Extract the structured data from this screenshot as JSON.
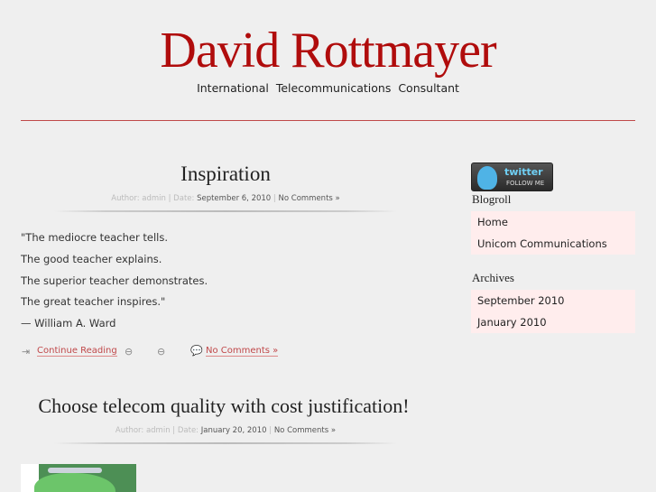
{
  "header": {
    "title": "David Rottmayer",
    "tagline": "International  Telecommunications  Consultant"
  },
  "posts": [
    {
      "title": "Inspiration",
      "meta_prefix": "Author: admin | Date: ",
      "date": "September 6, 2010",
      "meta_sep": " | ",
      "comments": "No Comments »",
      "lines": [
        "\"The mediocre teacher tells.",
        "The good teacher explains.",
        "The superior teacher demonstrates.",
        "The great teacher inspires.\"",
        "— William A. Ward"
      ],
      "continue": "Continue Reading",
      "comments_link": "No Comments »"
    },
    {
      "title": "Choose telecom quality with cost justification!",
      "meta_prefix": "Author: admin | Date: ",
      "date": "January 20, 2010",
      "meta_sep": " | ",
      "comments": "No Comments »"
    }
  ],
  "sidebar": {
    "twitter": {
      "brand": "twitter",
      "label": "FOLLOW ME"
    },
    "blogroll": {
      "heading": "Blogroll",
      "items": [
        "Home",
        "Unicom Communications"
      ]
    },
    "archives": {
      "heading": "Archives",
      "items": [
        "September 2010",
        "January 2010"
      ]
    }
  }
}
